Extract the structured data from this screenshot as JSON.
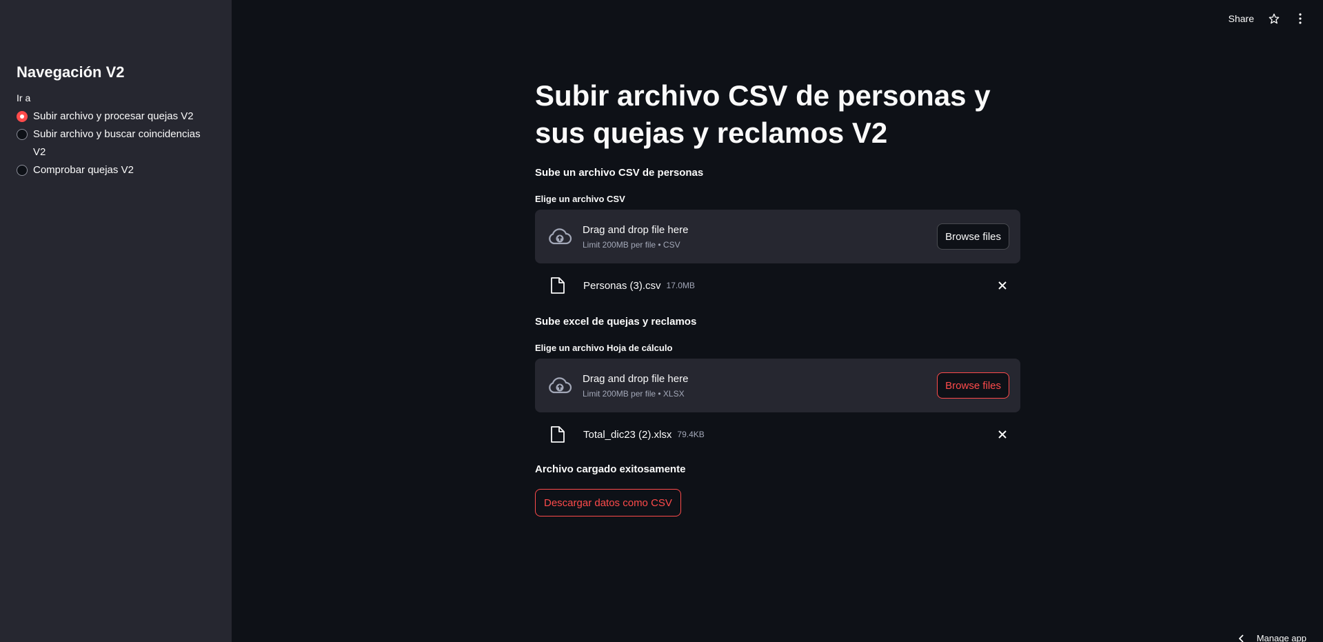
{
  "header": {
    "share_label": "Share",
    "star_icon": "star-icon",
    "menu_icon": "kebab-menu-icon"
  },
  "sidebar": {
    "title": "Navegación V2",
    "radio_label": "Ir a",
    "options": [
      {
        "label": "Subir archivo y procesar quejas V2",
        "selected": true
      },
      {
        "label": "Subir archivo y buscar coincidencias V2",
        "selected": false
      },
      {
        "label": "Comprobar quejas V2",
        "selected": false
      }
    ]
  },
  "main": {
    "title": "Subir archivo CSV de personas y sus quejas y reclamos V2",
    "section1": {
      "subheader": "Sube un archivo CSV de personas",
      "uploader_label": "Elige un archivo CSV",
      "drop_main": "Drag and drop file here",
      "drop_sub": "Limit 200MB per file • CSV",
      "browse_label": "Browse files",
      "file_name": "Personas (3).csv",
      "file_size": "17.0MB"
    },
    "section2": {
      "subheader": "Sube excel de quejas y reclamos",
      "uploader_label": "Elige un archivo Hoja de cálculo",
      "drop_main": "Drag and drop file here",
      "drop_sub": "Limit 200MB per file • XLSX",
      "browse_label": "Browse files",
      "file_name": "Total_dic23 (2).xlsx",
      "file_size": "79.4KB"
    },
    "status": "Archivo cargado exitosamente",
    "download_label": "Descargar datos como CSV"
  },
  "footer": {
    "manage_label": "Manage app"
  },
  "colors": {
    "background": "#0e1117",
    "sidebar": "#262730",
    "accent": "#ff4b4b"
  }
}
